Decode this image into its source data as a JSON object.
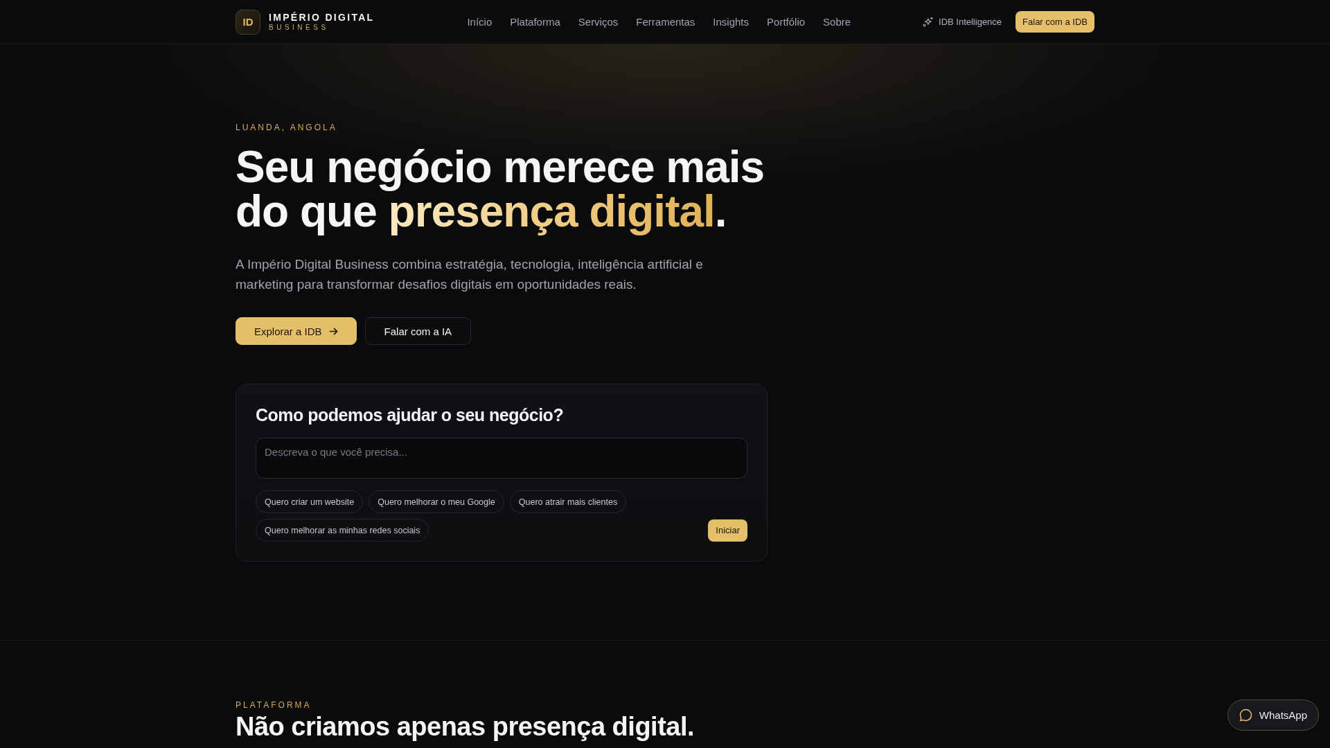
{
  "header": {
    "logo": {
      "badge": "ID",
      "name": "IMPÉRIO DIGITAL",
      "tagline": "BUSINESS"
    },
    "nav": [
      {
        "label": "Início"
      },
      {
        "label": "Plataforma"
      },
      {
        "label": "Serviços"
      },
      {
        "label": "Ferramentas"
      },
      {
        "label": "Insights"
      },
      {
        "label": "Portfólio"
      },
      {
        "label": "Sobre"
      }
    ],
    "ai_link": {
      "label": "IDB Intelligence"
    },
    "cta": {
      "label": "Falar com a IDB"
    }
  },
  "hero": {
    "eyebrow": "LUANDA, ANGOLA",
    "headline": [
      {
        "text": "Seu negócio merece mais do que ",
        "accent": false
      },
      {
        "text": "presença digital",
        "accent": true
      },
      {
        "text": ".",
        "accent": false
      }
    ],
    "intro": "A Império Digital Business combina estratégia, tecnologia, inteligência artificial e marketing para transformar desafios digitais em oportunidades reais.",
    "buttons": [
      {
        "label": "Explorar a IDB",
        "kind": "primary"
      },
      {
        "label": "Falar com a IA",
        "kind": "secondary"
      }
    ]
  },
  "assistant_card": {
    "title": "Como podemos ajudar o seu negócio?",
    "input": {
      "placeholder": "Descreva o que você precisa..."
    },
    "suggestions": [
      {
        "label": "Quero criar um website"
      },
      {
        "label": "Quero melhorar o meu Google"
      },
      {
        "label": "Quero atrair mais clientes"
      },
      {
        "label": "Quero melhorar as minhas redes sociais"
      }
    ],
    "submit": {
      "label": "Iniciar"
    }
  },
  "platform_section": {
    "eyebrow": "PLATAFORMA",
    "heading": "Não criamos apenas presença digital."
  },
  "whatsapp_button": {
    "label": "WhatsApp"
  }
}
